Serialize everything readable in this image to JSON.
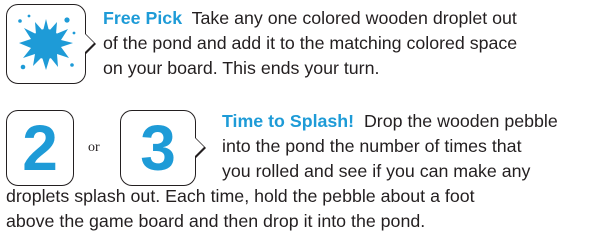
{
  "colors": {
    "accent": "#1e9bd7",
    "text": "#231f20",
    "border": "#231f20"
  },
  "icons": {
    "splash": "splash-icon",
    "die_two": "number-two-icon",
    "die_three": "number-three-icon"
  },
  "free_pick": {
    "heading": "Free Pick",
    "line1": "Take any one colored wooden droplet out",
    "line2": "of the pond and add it to the matching colored space",
    "line3": "on your board. This ends your turn."
  },
  "dice": {
    "two": "2",
    "or": "or",
    "three": "3"
  },
  "time_to_splash": {
    "heading": "Time to Splash!",
    "line1": "Drop the wooden pebble",
    "line2": "into the pond the number of times that",
    "line3": "you rolled and see if you can make any",
    "line4": "droplets splash out. Each time, hold the pebble about a foot",
    "line5": "above the game board and then drop it into the pond."
  }
}
